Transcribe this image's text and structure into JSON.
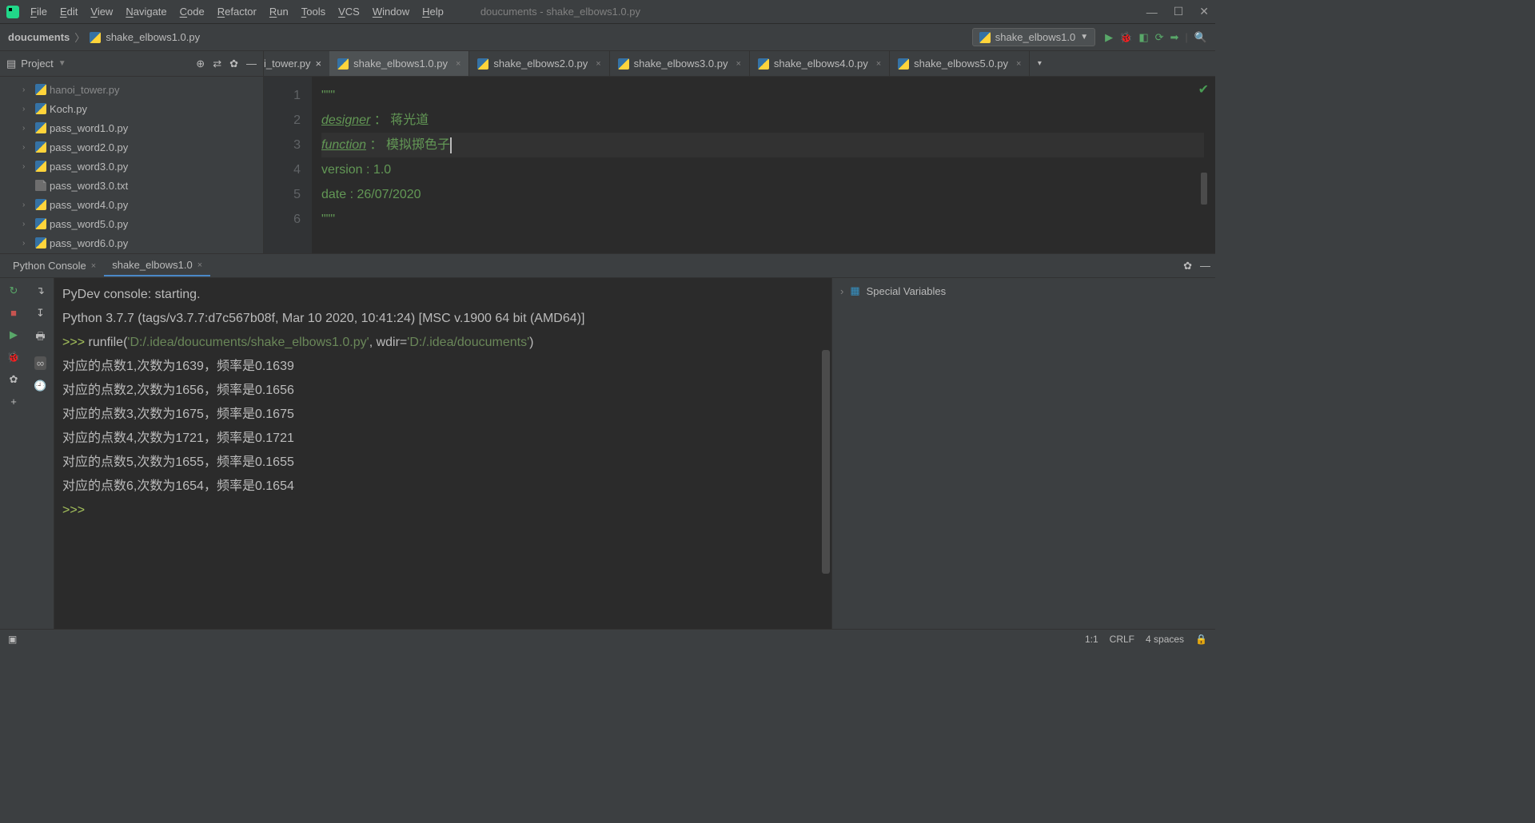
{
  "window": {
    "title": "doucuments - shake_elbows1.0.py"
  },
  "menu": [
    "File",
    "Edit",
    "View",
    "Navigate",
    "Code",
    "Refactor",
    "Run",
    "Tools",
    "VCS",
    "Window",
    "Help"
  ],
  "breadcrumb": {
    "root": "doucuments",
    "file": "shake_elbows1.0.py"
  },
  "run_config": "shake_elbows1.0",
  "sidebar": {
    "title": "Project",
    "items": [
      {
        "name": "hanoi_tower.py",
        "type": "py",
        "chevron": true,
        "cut": true
      },
      {
        "name": "Koch.py",
        "type": "py",
        "chevron": true
      },
      {
        "name": "pass_word1.0.py",
        "type": "py",
        "chevron": true
      },
      {
        "name": "pass_word2.0.py",
        "type": "py",
        "chevron": true
      },
      {
        "name": "pass_word3.0.py",
        "type": "py",
        "chevron": true
      },
      {
        "name": "pass_word3.0.txt",
        "type": "txt",
        "chevron": false
      },
      {
        "name": "pass_word4.0.py",
        "type": "py",
        "chevron": true
      },
      {
        "name": "pass_word5.0.py",
        "type": "py",
        "chevron": true
      },
      {
        "name": "pass_word6.0.py",
        "type": "py",
        "chevron": true
      }
    ]
  },
  "tabs": {
    "partial_left": "i_tower.py",
    "items": [
      {
        "label": "shake_elbows1.0.py",
        "active": true
      },
      {
        "label": "shake_elbows2.0.py",
        "active": false
      },
      {
        "label": "shake_elbows3.0.py",
        "active": false
      },
      {
        "label": "shake_elbows4.0.py",
        "active": false
      },
      {
        "label": "shake_elbows5.0.py",
        "active": false
      }
    ]
  },
  "editor": {
    "lines": [
      {
        "n": "1",
        "raw": "\"\"\"",
        "cls": "doc-str"
      },
      {
        "n": "2",
        "tag": "designer",
        "sep": " ： ",
        "val": "蒋光道"
      },
      {
        "n": "3",
        "tag": "function",
        "sep": " ： ",
        "val": "模拟掷色子",
        "current": true
      },
      {
        "n": "4",
        "tagplain": "version : 1.0"
      },
      {
        "n": "5",
        "tagplain": "date : 26/07/2020"
      },
      {
        "n": "6",
        "raw": "\"\"\"",
        "cls": "doc-str"
      }
    ]
  },
  "bottom_tabs": [
    {
      "label": "Python Console",
      "active": false
    },
    {
      "label": "shake_elbows1.0",
      "active": true
    }
  ],
  "console": {
    "lines": [
      "PyDev console: starting.",
      "",
      "Python 3.7.7 (tags/v3.7.7:d7c567b08f, Mar 10 2020, 10:41:24) [MSC v.1900 64 bit (AMD64)]"
    ],
    "run_prefix": ">>> ",
    "run_call": "runfile(",
    "run_arg1": "'D:/.idea/doucuments/shake_elbows1.0.py'",
    "run_mid": ", wdir=",
    "run_arg2": "'D:/.idea/doucuments'",
    "run_suffix": ")",
    "output": [
      "对应的点数1,次数为1639，频率是0.1639",
      "对应的点数2,次数为1656，频率是0.1656",
      "对应的点数3,次数为1675，频率是0.1675",
      "对应的点数4,次数为1721，频率是0.1721",
      "对应的点数5,次数为1655，频率是0.1655",
      "对应的点数6,次数为1654，频率是0.1654"
    ],
    "final_prompt": ">>> "
  },
  "vars_panel": {
    "label": "Special Variables"
  },
  "status": {
    "pos": "1:1",
    "eol": "CRLF",
    "indent": "4 spaces"
  }
}
